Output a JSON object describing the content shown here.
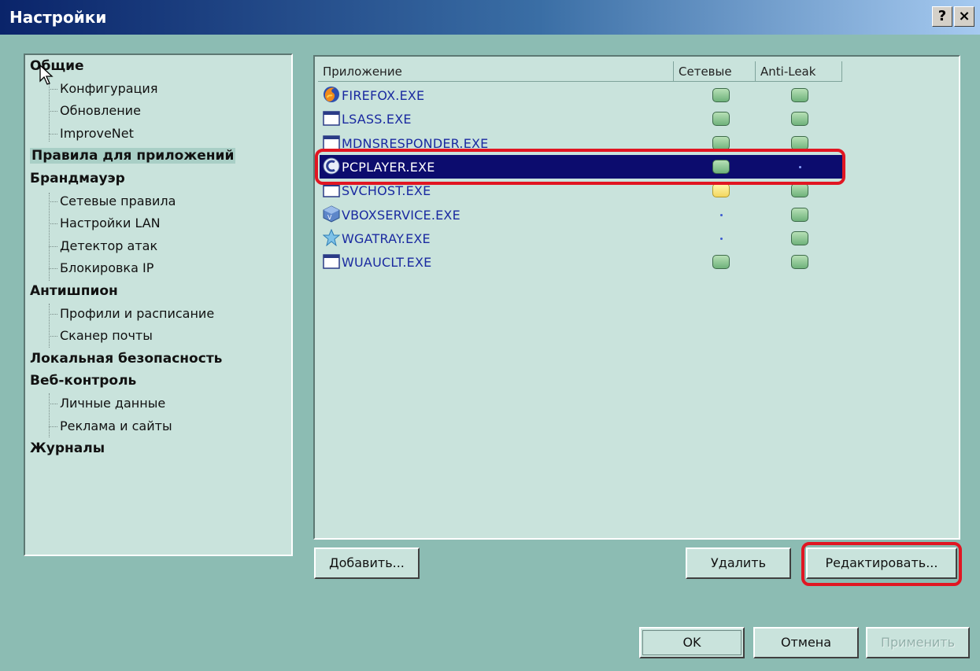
{
  "window": {
    "title": "Настройки",
    "help_label": "?",
    "close_label": "×"
  },
  "sidebar": {
    "items": [
      {
        "label": "Общие",
        "type": "category"
      },
      {
        "label": "Конфигурация",
        "type": "sub"
      },
      {
        "label": "Обновление",
        "type": "sub"
      },
      {
        "label": "ImproveNet",
        "type": "sub"
      },
      {
        "label": "Правила для приложений",
        "type": "category",
        "selected": true
      },
      {
        "label": "Брандмауэр",
        "type": "category"
      },
      {
        "label": "Сетевые правила",
        "type": "sub"
      },
      {
        "label": "Настройки LAN",
        "type": "sub"
      },
      {
        "label": "Детектор атак",
        "type": "sub"
      },
      {
        "label": "Блокировка IP",
        "type": "sub"
      },
      {
        "label": "Антишпион",
        "type": "category"
      },
      {
        "label": "Профили и расписание",
        "type": "sub"
      },
      {
        "label": "Сканер почты",
        "type": "sub"
      },
      {
        "label": "Локальная безопасность",
        "type": "category"
      },
      {
        "label": "Веб-контроль",
        "type": "category"
      },
      {
        "label": "Личные данные",
        "type": "sub"
      },
      {
        "label": "Реклама и сайты",
        "type": "sub"
      },
      {
        "label": "Журналы",
        "type": "category"
      }
    ]
  },
  "apps": {
    "columns": [
      "Приложение",
      "Сетевые",
      "Anti-Leak"
    ],
    "rows": [
      {
        "name": "FIREFOX.EXE",
        "icon": "firefox-icon",
        "network": "green",
        "antileak": "green"
      },
      {
        "name": "LSASS.EXE",
        "icon": "window-icon",
        "network": "green",
        "antileak": "green"
      },
      {
        "name": "MDNSRESPONDER.EXE",
        "icon": "window-icon",
        "network": "green",
        "antileak": "green"
      },
      {
        "name": "PCPLAYER.EXE",
        "icon": "pcplayer-icon",
        "network": "green",
        "antileak": "dot",
        "selected": true
      },
      {
        "name": "SVCHOST.EXE",
        "icon": "window-icon",
        "network": "yellow",
        "antileak": "green"
      },
      {
        "name": "VBOXSERVICE.EXE",
        "icon": "vbox-icon",
        "network": "dot",
        "antileak": "green"
      },
      {
        "name": "WGATRAY.EXE",
        "icon": "wga-icon",
        "network": "dot",
        "antileak": "green"
      },
      {
        "name": "WUAUCLT.EXE",
        "icon": "window-icon",
        "network": "green",
        "antileak": "green"
      }
    ]
  },
  "buttons": {
    "add": "Добавить...",
    "delete": "Удалить",
    "edit": "Редактировать...",
    "ok": "OK",
    "cancel": "Отмена",
    "apply": "Применить"
  },
  "colors": {
    "background": "#8cbcb3",
    "panel": "#c9e3dc",
    "selection": "#0c0c6e",
    "highlight": "#e11622"
  }
}
